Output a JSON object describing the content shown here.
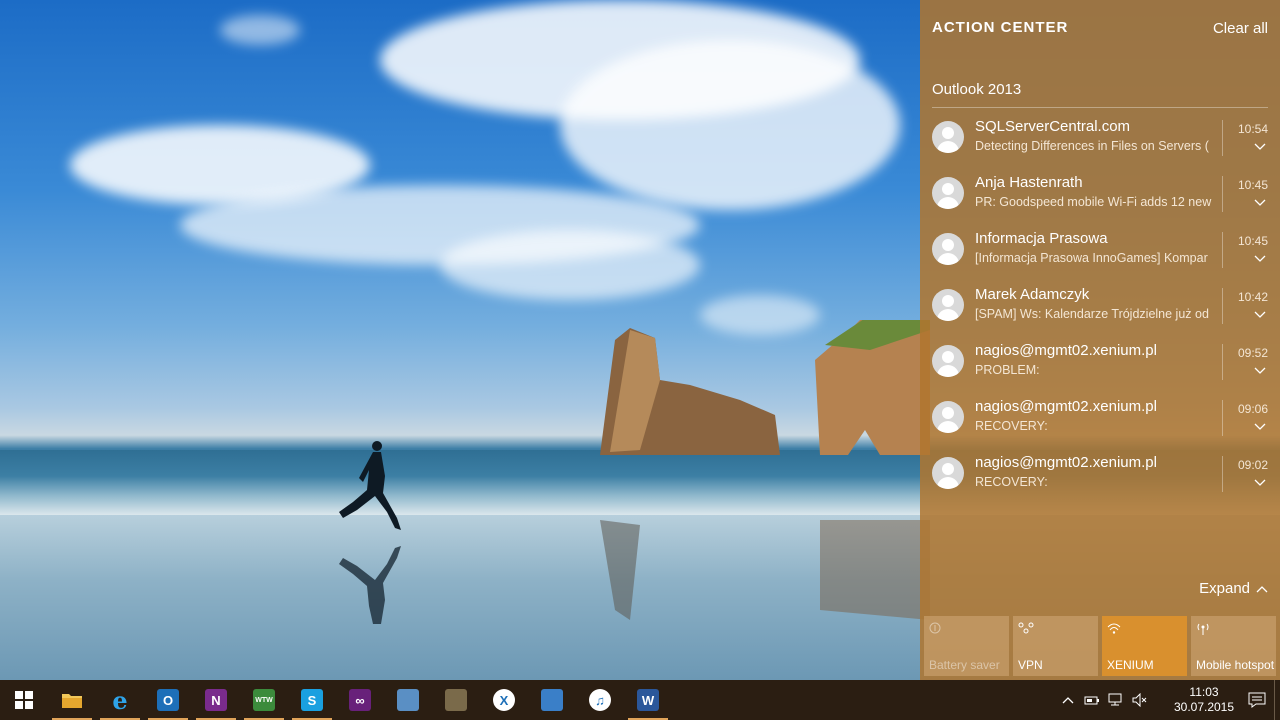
{
  "action_center": {
    "header": "ACTION CENTER",
    "clear_all": "Clear all",
    "group_title": "Outlook 2013",
    "notifications": [
      {
        "sender": "SQLServerCentral.com",
        "preview": "Detecting Differences in Files on Servers (",
        "time": "10:54"
      },
      {
        "sender": "Anja Hastenrath",
        "preview": "PR: Goodspeed mobile Wi-Fi adds 12 new",
        "time": "10:45"
      },
      {
        "sender": "Informacja Prasowa",
        "preview": "[Informacja Prasowa InnoGames] Kompar",
        "time": "10:45"
      },
      {
        "sender": "Marek Adamczyk",
        "preview": "[SPAM] Ws: Kalendarze Trójdzielne już od",
        "time": "10:42"
      },
      {
        "sender": "nagios@mgmt02.xenium.pl",
        "preview": "PROBLEM:",
        "time": "09:52"
      },
      {
        "sender": "nagios@mgmt02.xenium.pl",
        "preview": "RECOVERY:",
        "time": "09:06"
      },
      {
        "sender": "nagios@mgmt02.xenium.pl",
        "preview": "RECOVERY:",
        "time": "09:02"
      }
    ],
    "expand_label": "Expand",
    "quick_actions": [
      {
        "label": "Battery saver",
        "icon": "battery-saver-icon",
        "state": "disabled"
      },
      {
        "label": "VPN",
        "icon": "vpn-icon",
        "state": "off"
      },
      {
        "label": "XENIUM",
        "icon": "wifi-icon",
        "state": "on"
      },
      {
        "label": "Mobile hotspot",
        "icon": "mobile-hotspot-icon",
        "state": "off"
      }
    ],
    "accent_color": "#d9902e"
  },
  "taskbar": {
    "apps": [
      {
        "name": "start",
        "icon": "windows-logo-icon"
      },
      {
        "name": "file-explorer",
        "icon": "folder-icon",
        "open": true
      },
      {
        "name": "internet-explorer",
        "icon": "ie-icon",
        "open": true,
        "glyph": "e"
      },
      {
        "name": "outlook",
        "icon": "outlook-icon",
        "open": true,
        "glyph": "O"
      },
      {
        "name": "onenote",
        "icon": "onenote-icon",
        "open": true,
        "glyph": "N"
      },
      {
        "name": "wtw",
        "icon": "wtw-icon",
        "open": true,
        "glyph": "WTW"
      },
      {
        "name": "skype",
        "icon": "skype-icon",
        "open": true,
        "glyph": "S"
      },
      {
        "name": "visual-studio",
        "icon": "visual-studio-icon",
        "glyph": "∞"
      },
      {
        "name": "remote-tool",
        "icon": "remote-tool-icon"
      },
      {
        "name": "toolbox",
        "icon": "toolbox-icon"
      },
      {
        "name": "xmanager",
        "icon": "xmanager-icon",
        "glyph": "X"
      },
      {
        "name": "network",
        "icon": "network-icon"
      },
      {
        "name": "itunes",
        "icon": "itunes-icon",
        "glyph": "♫"
      },
      {
        "name": "word",
        "icon": "word-icon",
        "open": true,
        "glyph": "W"
      }
    ],
    "tray": {
      "time": "11:03",
      "date": "30.07.2015"
    }
  }
}
